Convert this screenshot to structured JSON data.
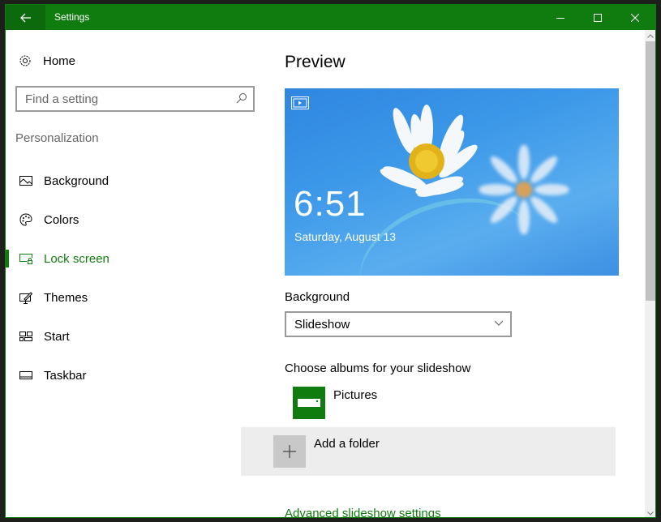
{
  "window": {
    "title": "Settings",
    "colors": {
      "accent": "#107c10",
      "titlebar": "#107c10"
    }
  },
  "sidebar": {
    "home_label": "Home",
    "search": {
      "placeholder": "Find a setting",
      "value": ""
    },
    "section_label": "Personalization",
    "items": [
      {
        "label": "Background",
        "icon": "picture-icon",
        "selected": false
      },
      {
        "label": "Colors",
        "icon": "palette-icon",
        "selected": false
      },
      {
        "label": "Lock screen",
        "icon": "lock-screen-icon",
        "selected": true
      },
      {
        "label": "Themes",
        "icon": "themes-icon",
        "selected": false
      },
      {
        "label": "Start",
        "icon": "start-icon",
        "selected": false
      },
      {
        "label": "Taskbar",
        "icon": "taskbar-icon",
        "selected": false
      }
    ]
  },
  "main": {
    "title": "Preview",
    "preview": {
      "time": "6:51",
      "date": "Saturday, August 13"
    },
    "background_label": "Background",
    "background_select": {
      "value": "Slideshow"
    },
    "albums_label": "Choose albums for your slideshow",
    "albums": [
      {
        "name": "Pictures",
        "icon": "pictures-folder-icon"
      },
      {
        "name": "Add a folder",
        "icon": "plus-icon"
      }
    ],
    "advanced_link": "Advanced slideshow settings"
  }
}
